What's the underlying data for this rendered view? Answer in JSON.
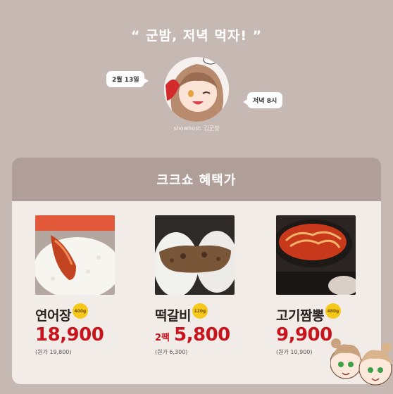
{
  "header": {
    "title": "“ 군밤, 저녁 먹자! ”",
    "date_bubble": "2월 13일",
    "time_bubble": "저녁 8시",
    "host": "showhost. 김군장"
  },
  "deal": {
    "title": "크크쇼 혜택가",
    "products": [
      {
        "name": "연어장",
        "weight": "400g",
        "pack": "",
        "price": "18,900",
        "original": "(원가 19,800)"
      },
      {
        "name": "떡갈비",
        "weight": "120g",
        "pack": "2팩",
        "price": "5,800",
        "original": "(원가 6,300)"
      },
      {
        "name": "고기짬뽕",
        "weight": "480g",
        "pack": "",
        "price": "9,900",
        "original": "(원가 10,900)"
      }
    ]
  },
  "colors": {
    "background": "#c6b9b4",
    "header_band": "#b09f98",
    "card": "#f2ece9",
    "price": "#c8141d",
    "badge": "#f6c81a"
  },
  "icons": {
    "avatar": "host-cartoon-avatar",
    "mascots": "twin-cartoon-mascots"
  }
}
